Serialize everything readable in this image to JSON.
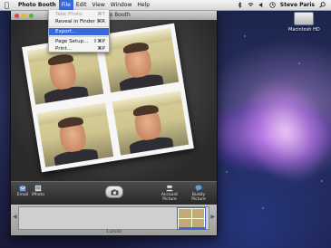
{
  "menubar": {
    "app_name": "Photo Booth",
    "menus": [
      "File",
      "Edit",
      "View",
      "Window",
      "Help"
    ],
    "active_menu": "File",
    "user": "Steve Paris"
  },
  "file_menu": {
    "items": [
      {
        "label": "Take Photo",
        "shortcut": "⌘T",
        "enabled": false
      },
      {
        "label": "Reveal in Finder",
        "shortcut": "⌘R",
        "enabled": true
      },
      {
        "label": "Export...",
        "shortcut": "",
        "enabled": true,
        "highlighted": true
      },
      {
        "label": "Page Setup...",
        "shortcut": "⇧⌘P",
        "enabled": true
      },
      {
        "label": "Print...",
        "shortcut": "⌘P",
        "enabled": true
      }
    ]
  },
  "window": {
    "title": "Photo Booth"
  },
  "toolbar": {
    "email_label": "Email",
    "iphoto_label": "iPhoto",
    "account_label": "Account Picture",
    "buddy_label": "Buddy Picture"
  },
  "filmstrip": {
    "count_label": "1 photo"
  },
  "desktop": {
    "drive_label": "Macintosh HD"
  },
  "colors": {
    "selection": "#3a68d8",
    "window_dark": "#2b2b2b"
  },
  "icons": [
    "apple-icon",
    "bluetooth-icon",
    "wifi-icon",
    "volume-icon",
    "clock-icon",
    "spotlight-icon",
    "email-icon",
    "iphoto-icon",
    "camera-icon",
    "account-icon",
    "buddy-icon",
    "hard-drive-icon"
  ]
}
